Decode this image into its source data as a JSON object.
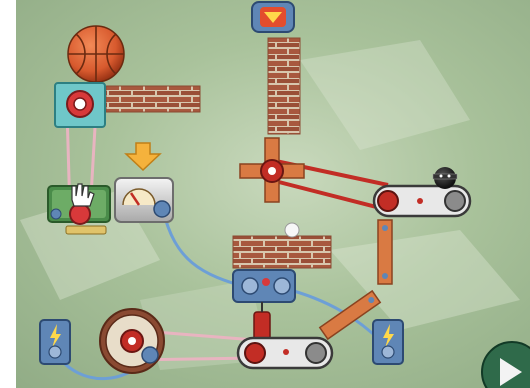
{
  "game": {
    "parts": [
      "basketball",
      "pinwheel-gear",
      "brick-wall",
      "down-arrow-hint",
      "pressure-gauge",
      "glove-motor",
      "cross-windmill",
      "bowling-ball",
      "conveyor-belt",
      "battery",
      "dynamite",
      "hamster-wheel",
      "baseball",
      "plank"
    ],
    "buttons": {
      "drop_icon": "down-triangle-icon",
      "play_icon": "play-triangle-icon"
    },
    "colors": {
      "brick": "#a8583e",
      "mortar": "#d8c6ad",
      "belt_red": "#c22d25",
      "rope_blue": "#6d9fd6",
      "rope_pink": "#e8b4c0",
      "panel_blue": "#5f86b6"
    }
  }
}
